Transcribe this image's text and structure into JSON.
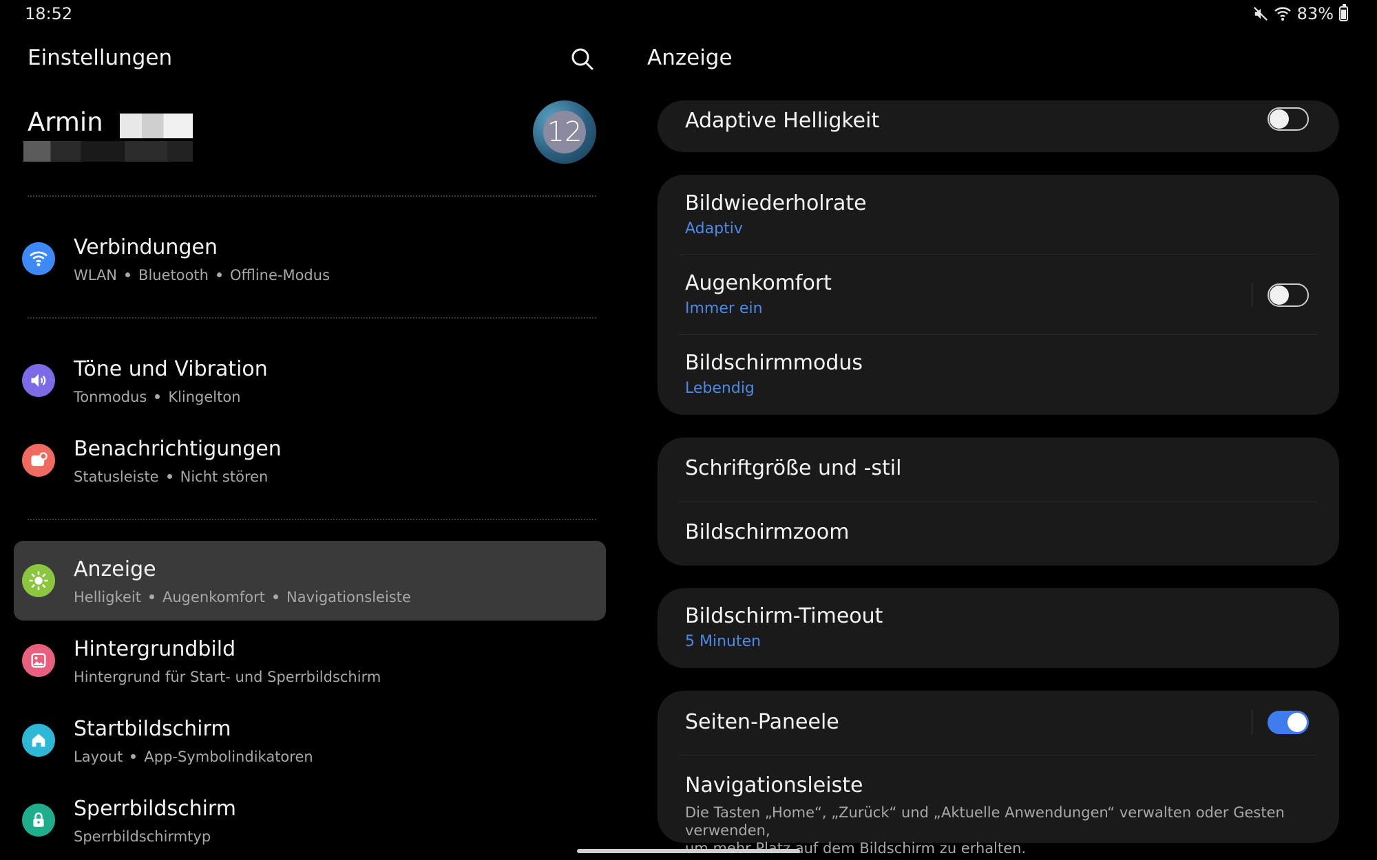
{
  "status_bar": {
    "time": "18:52",
    "battery_percent": "83%",
    "icons": [
      "mute-icon",
      "wifi-icon",
      "battery-icon"
    ]
  },
  "left_pane": {
    "title": "Einstellungen",
    "profile": {
      "name": "Armin",
      "avatar_text": "12"
    },
    "items": [
      {
        "label": "Verbindungen",
        "sub": [
          "WLAN",
          "Bluetooth",
          "Offline-Modus"
        ],
        "icon": "wifi-icon",
        "color": "#3d8af7"
      },
      {
        "label": "Töne und Vibration",
        "sub": [
          "Tonmodus",
          "Klingelton"
        ],
        "icon": "speaker-icon",
        "color": "#7b6be6"
      },
      {
        "label": "Benachrichtigungen",
        "sub": [
          "Statusleiste",
          "Nicht stören"
        ],
        "icon": "notification-icon",
        "color": "#ef6a5f"
      },
      {
        "label": "Anzeige",
        "sub": [
          "Helligkeit",
          "Augenkomfort",
          "Navigationsleiste"
        ],
        "icon": "sun-icon",
        "color": "#8cc63f",
        "active": true
      },
      {
        "label": "Hintergrundbild",
        "sub": [
          "Hintergrund für Start- und Sperrbildschirm"
        ],
        "icon": "image-icon",
        "color": "#e9607e"
      },
      {
        "label": "Startbildschirm",
        "sub": [
          "Layout",
          "App-Symbolindikatoren"
        ],
        "icon": "home-icon",
        "color": "#2eb8d8"
      },
      {
        "label": "Sperrbildschirm",
        "sub": [
          "Sperrbildschirmtyp"
        ],
        "icon": "lock-icon",
        "color": "#1fae8c"
      }
    ]
  },
  "right_pane": {
    "title": "Anzeige",
    "adaptive_brightness": {
      "label": "Adaptive Helligkeit",
      "enabled": false
    },
    "refresh_rate": {
      "label": "Bildwiederholrate",
      "value": "Adaptiv"
    },
    "eye_comfort": {
      "label": "Augenkomfort",
      "value": "Immer ein",
      "enabled": false
    },
    "screen_mode": {
      "label": "Bildschirmmodus",
      "value": "Lebendig"
    },
    "font": {
      "label": "Schriftgröße und -stil"
    },
    "zoom": {
      "label": "Bildschirmzoom"
    },
    "timeout": {
      "label": "Bildschirm-Timeout",
      "value": "5 Minuten"
    },
    "edge_panels": {
      "label": "Seiten-Paneele",
      "enabled": true
    },
    "nav_bar": {
      "label": "Navigationsleiste",
      "desc_1": "Die Tasten „Home“, „Zurück“ und „Aktuelle Anwendungen“ verwalten oder Gesten verwenden,",
      "desc_2": "um mehr Platz auf dem Bildschirm zu erhalten."
    }
  },
  "colors": {
    "accent_blue": "#4d8ae6",
    "toggle_on": "#3e7cf0",
    "card_bg": "#1a1a1a",
    "active_row": "#3a3a3a"
  }
}
